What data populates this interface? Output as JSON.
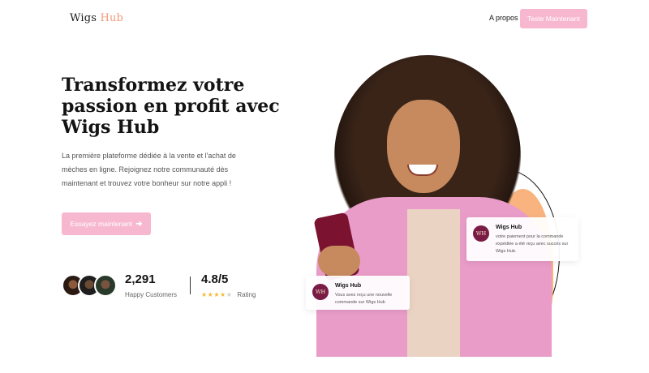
{
  "header": {
    "logo_main": "Wigs",
    "logo_accent": "Hub",
    "nav_about": "A propos",
    "nav_cta": "Teste Maintenant"
  },
  "hero": {
    "title": "Transformez votre passion en profit avec Wigs Hub",
    "description": "La première plateforme dédiée à la vente et l'achat de mèches en ligne. Rejoignez notre communauté dès maintenant et trouvez votre bonheur sur notre appli !",
    "cta_label": "Essayez maintenant",
    "cta_icon": "arrow-right-icon"
  },
  "stats": {
    "customers_value": "2,291",
    "customers_label": "Happy Customers",
    "rating_value": "4.8/5",
    "rating_label": "Rating",
    "stars_filled": 4,
    "stars_total": 5
  },
  "notifications": {
    "right": {
      "badge": "WH",
      "title": "Wigs Hub",
      "body": "votre paiement pour la commande expédiée a été reçu avec succès sur Wigs Hub."
    },
    "left": {
      "badge": "WH",
      "title": "Wigs Hub",
      "body": "Vous avez reçu une nouvelle commande sur Wigs Hub"
    }
  },
  "colors": {
    "accent_pink": "#f7b8cf",
    "brand_peach": "#f29a7a",
    "badge_maroon": "#7a1b45",
    "star_gold": "#f5b93a"
  }
}
